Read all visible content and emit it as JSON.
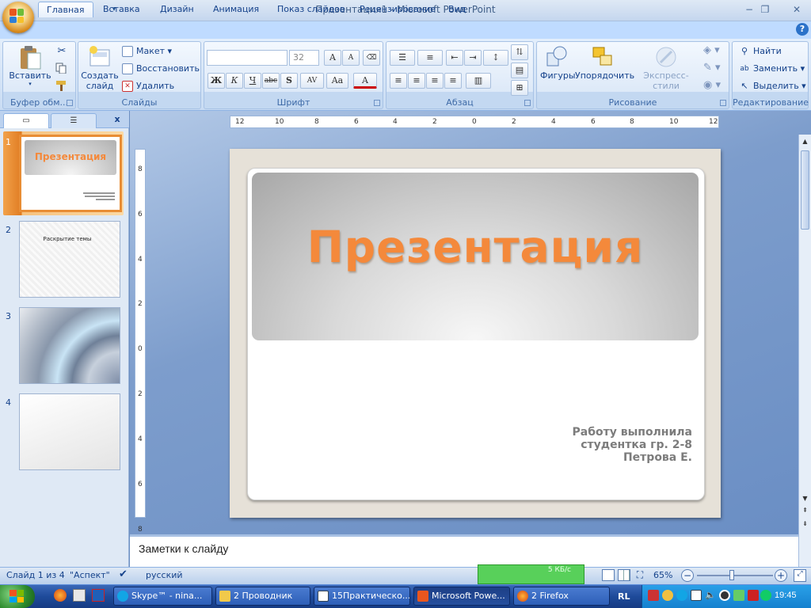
{
  "window": {
    "title": "Презентация1 - Microsoft PowerPoint",
    "minimize_glyph": "−",
    "restore_glyph": "❐",
    "close_glyph": "✕"
  },
  "tabs": [
    {
      "label": "Главная"
    },
    {
      "label": "Вставка"
    },
    {
      "label": "Дизайн"
    },
    {
      "label": "Анимация"
    },
    {
      "label": "Показ слайдов"
    },
    {
      "label": "Рецензирование"
    },
    {
      "label": "Вид"
    }
  ],
  "ribbon": {
    "clipboard": {
      "label": "Буфер обм...",
      "paste": "Вставить"
    },
    "slides": {
      "label": "Слайды",
      "new_slide_line1": "Создать",
      "new_slide_line2": "слайд",
      "layout": "Макет",
      "reset": "Восстановить",
      "delete": "Удалить"
    },
    "font": {
      "label": "Шрифт",
      "font_name": "",
      "font_size": "32",
      "bold": "Ж",
      "italic": "К",
      "underline": "Ч",
      "strike": "abc",
      "shadow": "S",
      "spacing": "AV",
      "case": "Aa",
      "color": "A",
      "grow": "A",
      "shrink": "A"
    },
    "paragraph": {
      "label": "Абзац"
    },
    "drawing": {
      "label": "Рисование",
      "shapes": "Фигуры",
      "arrange": "Упорядочить",
      "quick_styles": "Экспресс-стили"
    },
    "editing": {
      "label": "Редактирование",
      "find": "Найти",
      "replace": "Заменить",
      "select": "Выделить"
    }
  },
  "slides_panel": {
    "thumbnails": [
      {
        "number": "1",
        "title": "Презентация",
        "selected": true
      },
      {
        "number": "2",
        "title": "Раскрытие темы"
      },
      {
        "number": "3",
        "title": ""
      },
      {
        "number": "4",
        "title": ""
      }
    ],
    "close_glyph": "x"
  },
  "ruler": {
    "h_marks": [
      "12",
      "10",
      "8",
      "6",
      "4",
      "2",
      "0",
      "2",
      "4",
      "6",
      "8",
      "10",
      "12"
    ],
    "v_marks": [
      "8",
      "6",
      "4",
      "2",
      "0",
      "2",
      "4",
      "6",
      "8"
    ]
  },
  "slide": {
    "title": "Презентация",
    "subtitle_lines": [
      "Работу выполнила",
      "студентка гр. 2-8",
      "Петрова Е."
    ],
    "colors": {
      "title": "#f4893b",
      "subtitle": "#7c7c7c"
    }
  },
  "notes": {
    "placeholder": "Заметки к слайду"
  },
  "status": {
    "slide_counter": "Слайд 1 из 4",
    "theme": "\"Аспект\"",
    "language": "русский",
    "zoom": "65%",
    "zoom_fraction": 0.46,
    "network_label": "5 КБ/с"
  },
  "taskbar": {
    "items": [
      {
        "label": "Skype™ - nina..."
      },
      {
        "label": "2 Проводник"
      },
      {
        "label": "15Практическо..."
      },
      {
        "label": "Microsoft Powe..."
      },
      {
        "label": "2 Firefox"
      }
    ],
    "lang": "RL",
    "clock": "19:45"
  }
}
